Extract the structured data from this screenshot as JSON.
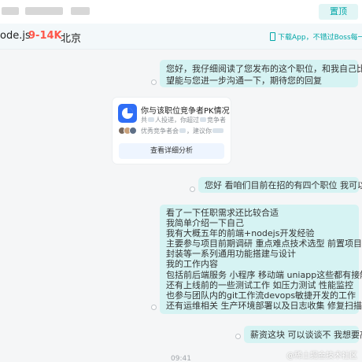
{
  "header": {
    "top_button_label": "置顶"
  },
  "job": {
    "title": "ode.js",
    "salary": "9-14K",
    "city": "北京",
    "app_tip": "下载App，不错过Boss每一条消息"
  },
  "messages": [
    {
      "lines": [
        "您好，我仔细阅读了您发布的这个职位，和我自己比较匹配，希",
        "望能与您进一步沟通一下，期待您的回复"
      ]
    },
    {
      "lines": [
        "您好 看咱们目前在招的有四个职位 我可以胜任三个"
      ]
    },
    {
      "lines": [
        "看了一下任职需求还比较合适",
        "我简单介绍一下自己",
        "我有大概五年的前端+nodejs开发经验",
        "主要参与项目前期调研 重点难点技术选型 前置项目脚手架 组件",
        "封装等一系列通用功能搭建与设计",
        "我的工作内容",
        "包括前后端服务 小程序 移动端 uniapp这些都有接触",
        "还有上线前的一些测试工作 如压力测试 性能监控",
        "也参与团队内的git工作流devops敏捷开发的工作",
        "还有运维相关 生产环境部署以及日志收集 修复扫描漏洞等等"
      ]
    },
    {
      "lines": [
        "薪资这块 可以谈谈不 我想要高一些"
      ]
    }
  ],
  "pk_card": {
    "title": "你与该职位竞争者PK情况",
    "line1_a": "共",
    "line1_b": "人投递，你超过",
    "line1_c": "竞争者",
    "line2_a": "优秀竞争者会",
    "line2_b": "，建议你",
    "button_label": "查看详细分析",
    "icon": "pie-chart-icon"
  },
  "timestamp": "09:41",
  "watermark": "@稀土掘金技术社区",
  "colors": {
    "accent": "#00a6a7",
    "bubble": "#d6f3f3",
    "salary": "#fe574a",
    "pk_icon": "#2f6ef6"
  }
}
